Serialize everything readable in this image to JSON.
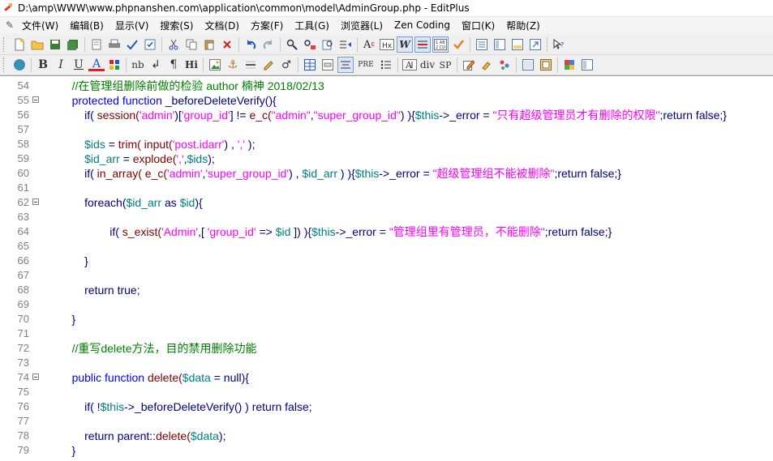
{
  "window": {
    "title": "D:\\amp\\WWW\\www.phpnanshen.com\\application\\common\\model\\AdminGroup.php - EditPlus"
  },
  "menu": [
    "文件(W)",
    "编辑(B)",
    "显示(V)",
    "搜索(S)",
    "文档(D)",
    "方案(F)",
    "工具(G)",
    "浏览器(L)",
    "Zen Coding",
    "窗口(K)",
    "帮助(Z)"
  ],
  "toolbar2_labels": {
    "bold": "B",
    "italic": "I",
    "underline": "U",
    "font_color": "A",
    "nbsp": "nb",
    "para": "¶",
    "heading": "Hi",
    "pre": "PRE",
    "hx": "Hx",
    "div": "div",
    "span": "SP"
  },
  "colors": {
    "comment": "#008000",
    "keyword": "#0000ff",
    "string": "#ff00ff",
    "variable": "#008080",
    "function": "#800000"
  },
  "editor": {
    "lines": [
      {
        "num": "54",
        "fold": false,
        "tokens": [
          [
            "    ",
            "bl"
          ],
          [
            "//在管理组删除前做的检验 author 楠神 2018/02/13",
            "cm"
          ]
        ]
      },
      {
        "num": "55",
        "fold": true,
        "tokens": [
          [
            "    ",
            "bl"
          ],
          [
            "protected function",
            "kw"
          ],
          [
            " _beforeDeleteVerify(){",
            "pl"
          ]
        ]
      },
      {
        "num": "56",
        "fold": false,
        "tokens": [
          [
            "        if(",
            "pl"
          ],
          [
            " session(",
            "fn"
          ],
          [
            "'admin'",
            "str"
          ],
          [
            ")[",
            "pl"
          ],
          [
            "'group_id'",
            "str"
          ],
          [
            "] != ",
            "pl"
          ],
          [
            "e_c(",
            "fn"
          ],
          [
            "\"admin\"",
            "str"
          ],
          [
            ",",
            "pl"
          ],
          [
            "\"super_group_id\"",
            "str"
          ],
          [
            ") ){",
            "pl"
          ],
          [
            "$this",
            "vr"
          ],
          [
            "->_error = ",
            "pl"
          ],
          [
            "\"只有超级管理员才有删除的权限\"",
            "str"
          ],
          [
            ";return false;}",
            "pl"
          ]
        ]
      },
      {
        "num": "57",
        "fold": false,
        "tokens": []
      },
      {
        "num": "58",
        "fold": false,
        "tokens": [
          [
            "        ",
            "bl"
          ],
          [
            "$ids",
            "vr"
          ],
          [
            " = ",
            "pl"
          ],
          [
            "trim(",
            "fn"
          ],
          [
            " input(",
            "fn"
          ],
          [
            "'post.idarr'",
            "str"
          ],
          [
            ") , ",
            "pl"
          ],
          [
            "','",
            "str"
          ],
          [
            " );",
            "pl"
          ]
        ]
      },
      {
        "num": "59",
        "fold": false,
        "tokens": [
          [
            "        ",
            "bl"
          ],
          [
            "$id_arr",
            "vr"
          ],
          [
            " = ",
            "pl"
          ],
          [
            "explode(",
            "fn"
          ],
          [
            "','",
            "str"
          ],
          [
            ",",
            "pl"
          ],
          [
            "$ids",
            "vr"
          ],
          [
            ");",
            "pl"
          ]
        ]
      },
      {
        "num": "60",
        "fold": false,
        "tokens": [
          [
            "        if(",
            "pl"
          ],
          [
            " in_array(",
            "fn"
          ],
          [
            " e_c(",
            "fn"
          ],
          [
            "'admin'",
            "str"
          ],
          [
            ",",
            "pl"
          ],
          [
            "'super_group_id'",
            "str"
          ],
          [
            ") , ",
            "pl"
          ],
          [
            "$id_arr",
            "vr"
          ],
          [
            " ) ){",
            "pl"
          ],
          [
            "$this",
            "vr"
          ],
          [
            "->_error = ",
            "pl"
          ],
          [
            "\"超级管理组不能被删除\"",
            "str"
          ],
          [
            ";return false;}",
            "pl"
          ]
        ]
      },
      {
        "num": "61",
        "fold": false,
        "tokens": []
      },
      {
        "num": "62",
        "fold": true,
        "tokens": [
          [
            "        foreach(",
            "pl"
          ],
          [
            "$id_arr",
            "vr"
          ],
          [
            " as ",
            "pl"
          ],
          [
            "$id",
            "vr"
          ],
          [
            "){",
            "pl"
          ]
        ]
      },
      {
        "num": "63",
        "fold": false,
        "tokens": []
      },
      {
        "num": "64",
        "fold": false,
        "tokens": [
          [
            "                if(",
            "pl"
          ],
          [
            " s_exist(",
            "fn"
          ],
          [
            "'Admin'",
            "str"
          ],
          [
            ",[ ",
            "pl"
          ],
          [
            "'group_id'",
            "str"
          ],
          [
            " => ",
            "pl"
          ],
          [
            "$id",
            "vr"
          ],
          [
            " ]) ){",
            "pl"
          ],
          [
            "$this",
            "vr"
          ],
          [
            "->_error = ",
            "pl"
          ],
          [
            "\"管理组里有管理员，不能删除\"",
            "str"
          ],
          [
            ";return false;}",
            "pl"
          ]
        ]
      },
      {
        "num": "65",
        "fold": false,
        "tokens": []
      },
      {
        "num": "66",
        "fold": false,
        "tokens": [
          [
            "        }",
            "pl"
          ]
        ]
      },
      {
        "num": "67",
        "fold": false,
        "tokens": []
      },
      {
        "num": "68",
        "fold": false,
        "tokens": [
          [
            "        return true;",
            "pl"
          ]
        ]
      },
      {
        "num": "69",
        "fold": false,
        "tokens": []
      },
      {
        "num": "70",
        "fold": false,
        "tokens": [
          [
            "    }",
            "pl"
          ]
        ]
      },
      {
        "num": "71",
        "fold": false,
        "tokens": []
      },
      {
        "num": "72",
        "fold": false,
        "tokens": [
          [
            "    ",
            "bl"
          ],
          [
            "//重写delete方法，目的禁用删除功能",
            "cm"
          ]
        ]
      },
      {
        "num": "73",
        "fold": false,
        "tokens": []
      },
      {
        "num": "74",
        "fold": true,
        "tokens": [
          [
            "    ",
            "bl"
          ],
          [
            "public function",
            "kw"
          ],
          [
            " ",
            "pl"
          ],
          [
            "delete(",
            "fn"
          ],
          [
            "$data",
            "vr"
          ],
          [
            " = null){",
            "pl"
          ]
        ]
      },
      {
        "num": "75",
        "fold": false,
        "tokens": []
      },
      {
        "num": "76",
        "fold": false,
        "tokens": [
          [
            "        if(",
            "pl"
          ],
          [
            " !",
            "pl"
          ],
          [
            "$this",
            "vr"
          ],
          [
            "->_beforeDeleteVerify() ) return false;",
            "pl"
          ]
        ]
      },
      {
        "num": "77",
        "fold": false,
        "tokens": []
      },
      {
        "num": "78",
        "fold": false,
        "tokens": [
          [
            "        return parent::",
            "pl"
          ],
          [
            "delete(",
            "fn"
          ],
          [
            "$data",
            "vr"
          ],
          [
            ");",
            "pl"
          ]
        ]
      },
      {
        "num": "79",
        "fold": false,
        "tokens": [
          [
            "    }",
            "pl"
          ]
        ]
      }
    ]
  }
}
